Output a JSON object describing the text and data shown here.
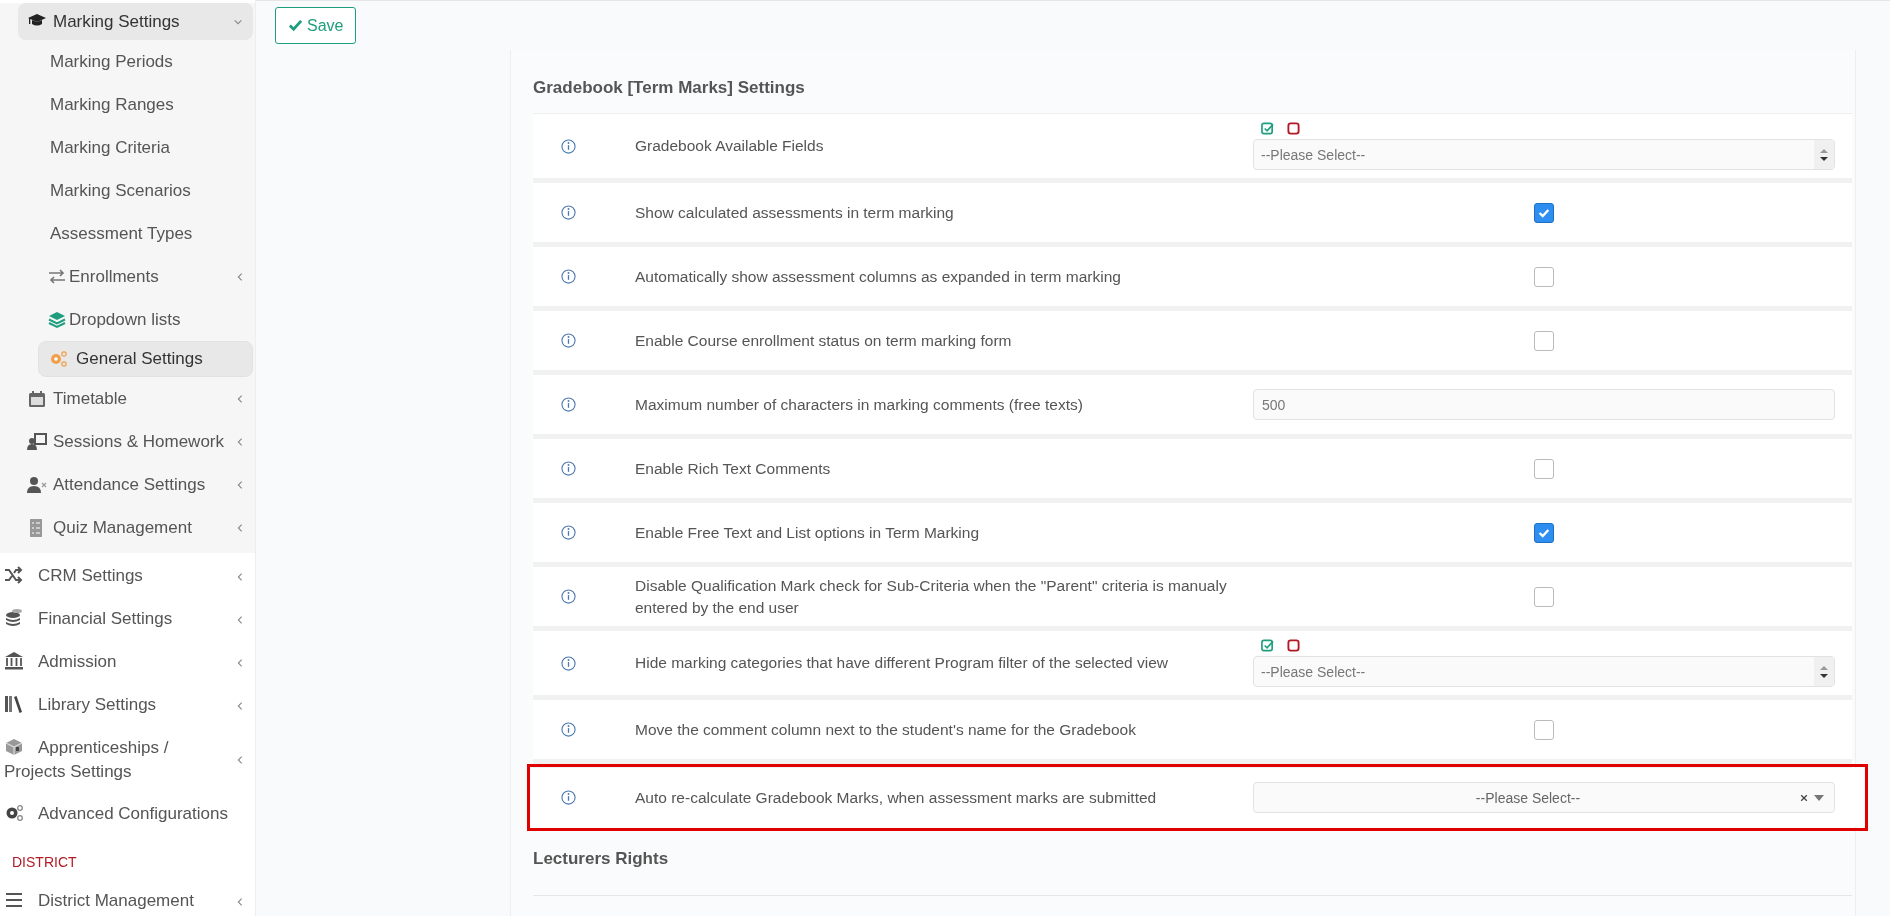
{
  "toolbar": {
    "save_button": "Save"
  },
  "sidebar": {
    "sections": [
      {
        "kind": "submenu",
        "items": [
          {
            "label": "Marking Settings",
            "kind": "menu",
            "expanded": true,
            "children": [
              {
                "label": "Marking Periods",
                "kind": "link",
                "selected": false
              },
              {
                "label": "Marking Ranges",
                "kind": "link",
                "selected": false
              },
              {
                "label": "Marking Criteria",
                "kind": "link",
                "selected": false
              },
              {
                "label": "Marking Scenarios",
                "kind": "link",
                "selected": false
              },
              {
                "label": "Assessment Types",
                "kind": "link",
                "selected": false
              },
              {
                "label": "Enrollments",
                "kind": "menu",
                "expanded": false
              },
              {
                "label": "Dropdown lists",
                "kind": "link",
                "selected": false
              },
              {
                "label": "General Settings",
                "kind": "link",
                "selected": true
              }
            ]
          },
          {
            "label": "Timetable",
            "kind": "menu",
            "expanded": false
          },
          {
            "label": "Sessions & Homework",
            "kind": "menu",
            "expanded": false
          },
          {
            "label": "Attendance Settings",
            "kind": "menu",
            "expanded": false
          },
          {
            "label": "Quiz Management",
            "kind": "menu",
            "expanded": false
          }
        ]
      },
      {
        "kind": "main",
        "items": [
          {
            "label": "CRM Settings",
            "kind": "menu",
            "expanded": false
          },
          {
            "label": "Financial Settings",
            "kind": "menu",
            "expanded": false
          },
          {
            "label": "Admission",
            "kind": "menu",
            "expanded": false
          },
          {
            "label": "Library Settings",
            "kind": "menu",
            "expanded": false
          },
          {
            "label": "Apprenticeships / Projects Settings",
            "kind": "menu",
            "expanded": false
          },
          {
            "label": "Advanced Configurations",
            "kind": "link",
            "selected": false
          }
        ]
      },
      {
        "kind": "header",
        "title": "DISTRICT",
        "items": [
          {
            "label": "District Management",
            "kind": "menu",
            "expanded": false
          }
        ]
      }
    ]
  },
  "settings_sections": [
    {
      "title": "Gradebook [Term Marks] Settings",
      "rows": [
        {
          "label": "Gradebook Available Fields",
          "kind": "multiselect",
          "placeholder": "--Please Select--",
          "highlighted": false
        },
        {
          "label": "Show calculated assessments in term marking",
          "kind": "checkbox",
          "checked": true,
          "highlighted": false
        },
        {
          "label": "Automatically show assessment columns as expanded in term marking",
          "kind": "checkbox",
          "checked": false,
          "highlighted": false
        },
        {
          "label": "Enable Course enrollment status on term marking form",
          "kind": "checkbox",
          "checked": false,
          "highlighted": false
        },
        {
          "label": "Maximum number of characters in marking comments (free texts)",
          "kind": "text",
          "value": "500",
          "highlighted": false
        },
        {
          "label": "Enable Rich Text Comments",
          "kind": "checkbox",
          "checked": false,
          "highlighted": false
        },
        {
          "label": "Enable Free Text and List options in Term Marking",
          "kind": "checkbox",
          "checked": true,
          "highlighted": false
        },
        {
          "label": "Disable Qualification Mark check for Sub-Criteria when the \"Parent\" criteria is manualy entered by the end user",
          "kind": "checkbox",
          "checked": false,
          "highlighted": false
        },
        {
          "label": "Hide marking categories that have different Program filter of the selected view",
          "kind": "multiselect",
          "placeholder": "--Please Select--",
          "highlighted": false
        },
        {
          "label": "Move the comment column next to the student's name for the Gradebook",
          "kind": "checkbox",
          "checked": false,
          "highlighted": false
        },
        {
          "label": "Auto re-calculate Gradebook Marks, when assessment marks are submitted",
          "kind": "select",
          "placeholder": "--Please Select--",
          "highlighted": true
        }
      ]
    },
    {
      "title": "Lecturers Rights"
    }
  ]
}
